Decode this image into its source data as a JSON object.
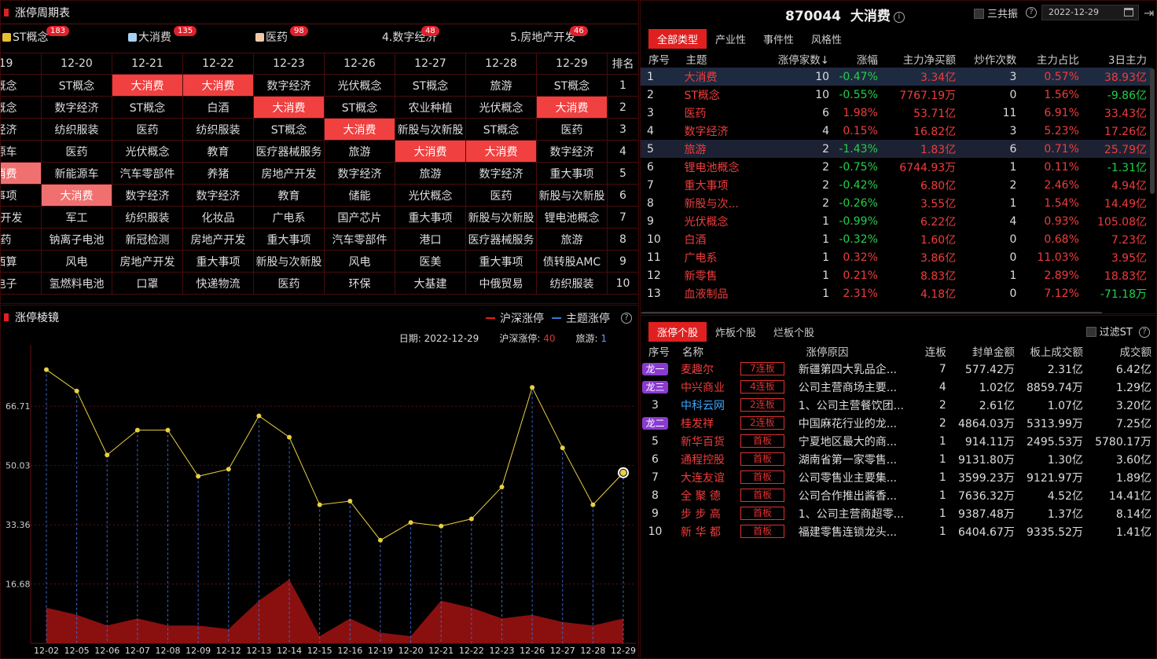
{
  "top_left": {
    "title": "涨停周期表",
    "tabs": [
      {
        "label": "ST概念",
        "badge": "183",
        "cube": "#e8c030"
      },
      {
        "label": "大消费",
        "badge": "135",
        "cube": "#a8d0f0"
      },
      {
        "label": "医药",
        "badge": "98",
        "cube": "#f0c8a8"
      },
      {
        "label": "4.数字经济",
        "badge": "48"
      },
      {
        "label": "5.房地产开发",
        "badge": "46"
      }
    ],
    "header": [
      "19",
      "12-20",
      "12-21",
      "12-22",
      "12-23",
      "12-26",
      "12-27",
      "12-28",
      "12-29",
      "排名"
    ],
    "rows": [
      [
        "概念",
        "ST概念",
        "大消费",
        "大消费",
        "数字经济",
        "光伏概念",
        "ST概念",
        "旅游",
        "ST概念",
        "1"
      ],
      [
        "概念",
        "数字经济",
        "ST概念",
        "白酒",
        "大消费",
        "ST概念",
        "农业种植",
        "光伏概念",
        "大消费",
        "2"
      ],
      [
        "经济",
        "纺织服装",
        "医药",
        "纺织服装",
        "ST概念",
        "大消费",
        "新股与次新股",
        "ST概念",
        "医药",
        "3"
      ],
      [
        "源车",
        "医药",
        "光伏概念",
        "教育",
        "医疗器械服务",
        "旅游",
        "大消费",
        "大消费",
        "数字经济",
        "4"
      ],
      [
        "消费",
        "新能源车",
        "汽车零部件",
        "养猪",
        "房地产开发",
        "数字经济",
        "旅游",
        "数字经济",
        "重大事项",
        "5"
      ],
      [
        "事项",
        "大消费",
        "数字经济",
        "数字经济",
        "教育",
        "储能",
        "光伏概念",
        "医药",
        "新股与次新股",
        "6"
      ],
      [
        "产开发",
        "军工",
        "纺织服装",
        "化妆品",
        "广电系",
        "国产芯片",
        "重大事项",
        "新股与次新股",
        "锂电池概念",
        "7"
      ],
      [
        "药",
        "钠离子电池",
        "新冠检测",
        "房地产开发",
        "重大事项",
        "汽车零部件",
        "港口",
        "医疗器械服务",
        "旅游",
        "8"
      ],
      [
        "西算",
        "风电",
        "房地产开发",
        "重大事项",
        "新股与次新股",
        "风电",
        "医美",
        "重大事项",
        "债转股AMC",
        "9"
      ],
      [
        "电子",
        "氢燃料电池",
        "口罩",
        "快递物流",
        "医药",
        "环保",
        "大基建",
        "中俄贸易",
        "纺织服装",
        "10"
      ]
    ]
  },
  "bottom_left": {
    "title": "涨停棱镜",
    "legend": [
      "沪深涨停",
      "主题涨停"
    ],
    "info": {
      "date_label": "日期:",
      "date": "2022-12-29",
      "hs_label": "沪深涨停:",
      "hs": "40",
      "theme_label": "旅游:",
      "theme": "1"
    }
  },
  "chart_data": {
    "type": "line",
    "x": [
      "12-02",
      "12-05",
      "12-06",
      "12-07",
      "12-08",
      "12-09",
      "12-12",
      "12-13",
      "12-14",
      "12-15",
      "12-16",
      "12-19",
      "12-20",
      "12-21",
      "12-22",
      "12-23",
      "12-26",
      "12-27",
      "12-28",
      "12-29"
    ],
    "yticks": [
      "66.71",
      "50.03",
      "33.36",
      "16.68"
    ],
    "ylim": [
      0,
      84
    ],
    "series": [
      {
        "name": "沪深涨停",
        "values": [
          77,
          71,
          53,
          60,
          60,
          47,
          49,
          64,
          58,
          39,
          40,
          29,
          34,
          33,
          35,
          44,
          72,
          55,
          39,
          48
        ]
      },
      {
        "name": "主题涨停",
        "values": [
          10,
          8,
          5,
          7,
          5,
          5,
          4,
          12,
          18,
          2,
          7,
          3,
          2,
          12,
          10,
          7,
          8,
          6,
          5,
          7
        ]
      }
    ]
  },
  "top_right": {
    "code": "870044",
    "name": "大消费",
    "sanban": "三共振",
    "date": "2022-12-29",
    "tabs": [
      "全部类型",
      "产业性",
      "事件性",
      "风格性"
    ],
    "cols": [
      "序号",
      "主题",
      "涨停家数↓",
      "涨幅",
      "主力净买额",
      "炒作次数",
      "主力占比",
      "3日主力"
    ],
    "rows": [
      [
        "1",
        "大消费",
        "10",
        "-0.47%",
        "3.34亿",
        "3",
        "0.57%",
        "38.93亿"
      ],
      [
        "2",
        "ST概念",
        "10",
        "-0.55%",
        "7767.19万",
        "0",
        "1.56%",
        "-9.86亿"
      ],
      [
        "3",
        "医药",
        "6",
        "1.98%",
        "53.71亿",
        "11",
        "6.91%",
        "33.43亿"
      ],
      [
        "4",
        "数字经济",
        "4",
        "0.15%",
        "16.82亿",
        "3",
        "5.23%",
        "17.26亿"
      ],
      [
        "5",
        "旅游",
        "2",
        "-1.43%",
        "1.83亿",
        "6",
        "0.71%",
        "25.79亿"
      ],
      [
        "6",
        "锂电池概念",
        "2",
        "-0.75%",
        "6744.93万",
        "1",
        "0.11%",
        "-1.31亿"
      ],
      [
        "7",
        "重大事项",
        "2",
        "-0.42%",
        "6.80亿",
        "2",
        "2.46%",
        "4.94亿"
      ],
      [
        "8",
        "新股与次...",
        "2",
        "-0.26%",
        "3.55亿",
        "1",
        "1.54%",
        "14.49亿"
      ],
      [
        "9",
        "光伏概念",
        "1",
        "-0.99%",
        "6.22亿",
        "4",
        "0.93%",
        "105.08亿"
      ],
      [
        "10",
        "白酒",
        "1",
        "-0.32%",
        "1.60亿",
        "0",
        "0.68%",
        "7.23亿"
      ],
      [
        "11",
        "广电系",
        "1",
        "0.32%",
        "3.86亿",
        "0",
        "11.03%",
        "3.95亿"
      ],
      [
        "12",
        "新零售",
        "1",
        "0.21%",
        "8.83亿",
        "1",
        "2.89%",
        "18.83亿"
      ],
      [
        "13",
        "血液制品",
        "1",
        "2.31%",
        "4.18亿",
        "0",
        "7.12%",
        "-71.18万"
      ]
    ]
  },
  "bottom_right": {
    "tabs": [
      "涨停个股",
      "炸板个股",
      "烂板个股"
    ],
    "filter": "过滤ST",
    "cols": [
      "序号",
      "名称",
      "涨停原因",
      "连板",
      "封单金额",
      "板上成交额",
      "成交额"
    ],
    "rows": [
      [
        "龙一",
        "麦趣尔",
        "7连板",
        "新疆第四大乳品企...",
        "7",
        "577.42万",
        "2.31亿",
        "6.42亿"
      ],
      [
        "龙三",
        "中兴商业",
        "4连板",
        "公司主营商场主要...",
        "4",
        "1.02亿",
        "8859.74万",
        "1.29亿"
      ],
      [
        "3",
        "中科云网",
        "2连板",
        "1、公司主营餐饮团...",
        "2",
        "2.61亿",
        "1.07亿",
        "3.20亿"
      ],
      [
        "龙二",
        "桂发祥",
        "2连板",
        "中国麻花行业的龙...",
        "2",
        "4864.03万",
        "5313.99万",
        "7.25亿"
      ],
      [
        "5",
        "新华百货",
        "首板",
        "宁夏地区最大的商...",
        "1",
        "914.11万",
        "2495.53万",
        "5780.17万"
      ],
      [
        "6",
        "通程控股",
        "首板",
        "湖南省第一家零售...",
        "1",
        "9131.80万",
        "1.30亿",
        "3.60亿"
      ],
      [
        "7",
        "大连友谊",
        "首板",
        "公司零售业主要集...",
        "1",
        "3599.23万",
        "9121.97万",
        "1.89亿"
      ],
      [
        "8",
        "全 聚 德",
        "首板",
        "公司合作推出酱香...",
        "1",
        "7636.32万",
        "4.52亿",
        "14.41亿"
      ],
      [
        "9",
        "步 步 高",
        "首板",
        "1、公司主营商超零...",
        "1",
        "9387.48万",
        "1.37亿",
        "8.14亿"
      ],
      [
        "10",
        "新 华 都",
        "首板",
        "福建零售连锁龙头...",
        "1",
        "6404.67万",
        "9335.52万",
        "1.41亿"
      ]
    ]
  }
}
